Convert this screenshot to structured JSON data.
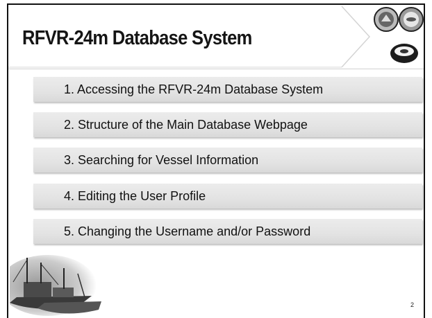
{
  "slide": {
    "title": "RFVR-24m Database System",
    "page_number": "2"
  },
  "menu": {
    "items": [
      {
        "label": "1. Accessing the RFVR-24m Database System"
      },
      {
        "label": "2. Structure of the Main Database Webpage"
      },
      {
        "label": "3. Searching for Vessel Information"
      },
      {
        "label": "4. Editing the User Profile"
      },
      {
        "label": "5. Changing the Username and/or Password"
      }
    ]
  },
  "logos": {
    "icons": [
      "asean-emblem-icon",
      "seafdec-emblem-icon",
      "jtf-logo-icon"
    ]
  },
  "decoration": {
    "icon": "fishing-boats-illustration-icon"
  },
  "colors": {
    "menu_bar": "#e3e3e3",
    "title_text": "#151515",
    "border": "#111111"
  }
}
